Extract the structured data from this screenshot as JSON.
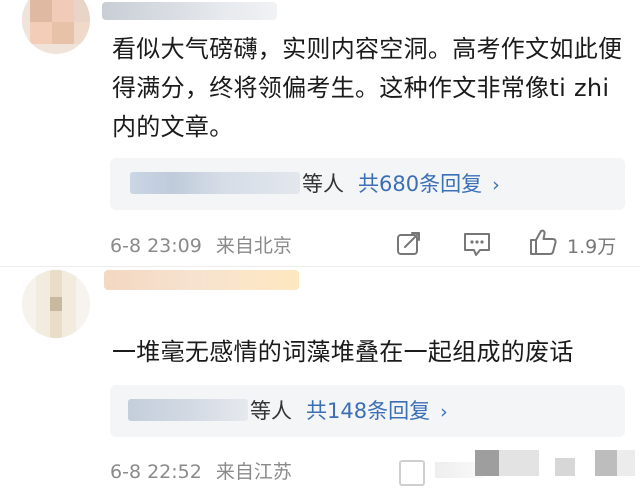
{
  "comments": [
    {
      "text": "看似大气磅礴，实则内容空洞。高考作文如此便得满分，终将领偏考生。这种作文非常像ti zhi内的文章。",
      "reply_suffix": "等人",
      "reply_count": "共680条回复",
      "time": "6-8 23:09",
      "location": "来自北京",
      "likes": "1.9万"
    },
    {
      "text": "一堆毫无感情的词藻堆叠在一起组成的废话",
      "reply_suffix": "等人",
      "reply_count": "共148条回复",
      "time": "6-8 22:52",
      "location": "来自江苏"
    }
  ],
  "icons": {
    "share": "share-icon",
    "comment": "comment-icon",
    "like": "thumbs-up-icon",
    "chevron": "chevron-right-icon"
  },
  "colors": {
    "link_blue": "#3b6fb6",
    "meta_gray": "#8a8a8a",
    "reply_bg": "#f4f5f7"
  }
}
